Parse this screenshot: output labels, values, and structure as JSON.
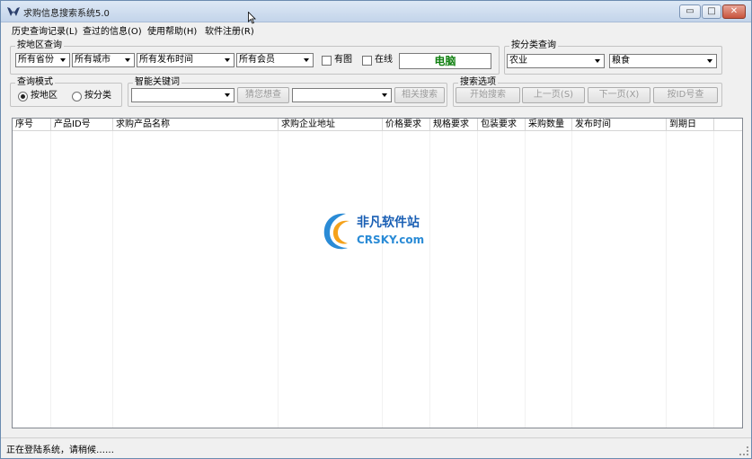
{
  "window": {
    "title": "求购信息搜索系统5.0",
    "min_glyph": "▭",
    "max_glyph": "□",
    "close_glyph": "✕"
  },
  "menu": [
    "历史查询记录(L)",
    "查过的信息(O)",
    "使用帮助(H)",
    "软件注册(R)"
  ],
  "region_group": {
    "title": "按地区查询",
    "province": "所有省份",
    "city": "所有城市",
    "publish_time": "所有发布时间",
    "member": "所有会员",
    "has_image_label": "有图",
    "online_label": "在线",
    "status_value": "电脑"
  },
  "category_group": {
    "title": "按分类查询",
    "category": "农业",
    "subcategory": "粮食"
  },
  "mode_group": {
    "title": "查询模式",
    "by_region": "按地区",
    "by_category": "按分类",
    "selected": "by_region"
  },
  "keyword_group": {
    "title": "智能关键词",
    "keyword": "",
    "guess_button": "猜您想查",
    "related": "",
    "related_button": "相关搜索"
  },
  "search_group": {
    "title": "搜索选项",
    "start_button": "开始搜索",
    "prev_button": "上一页(S)",
    "next_button": "下一页(X)",
    "id_button": "按ID号查"
  },
  "table": {
    "columns": [
      "序号",
      "产品ID号",
      "求购产品名称",
      "求购企业地址",
      "价格要求",
      "规格要求",
      "包装要求",
      "采购数量",
      "发布时间",
      "到期日"
    ]
  },
  "watermark": {
    "line1": "非凡软件站",
    "line2": "CRSKY.com"
  },
  "status": {
    "text": "正在登陆系统，请稍候……"
  },
  "colors": {
    "status_value": "#108010",
    "watermark_blue": "#1a5fb4"
  }
}
